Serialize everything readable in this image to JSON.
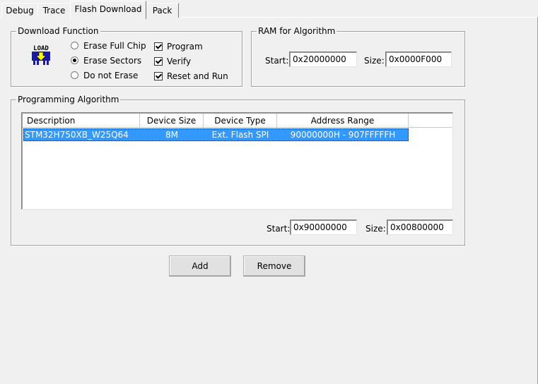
{
  "tabs": [
    {
      "label": "Debug",
      "active": false
    },
    {
      "label": "Trace",
      "active": false
    },
    {
      "label": "Flash Download",
      "active": true
    },
    {
      "label": "Pack",
      "active": false
    }
  ],
  "download_function": {
    "title": "Download Function",
    "icon": "load-icon",
    "icon_text": "LOAD",
    "radios": [
      {
        "label": "Erase Full Chip",
        "selected": false
      },
      {
        "label": "Erase Sectors",
        "selected": true
      },
      {
        "label": "Do not Erase",
        "selected": false
      }
    ],
    "checks": [
      {
        "label": "Program",
        "checked": true
      },
      {
        "label": "Verify",
        "checked": true
      },
      {
        "label": "Reset and Run",
        "checked": true
      }
    ]
  },
  "ram_algorithm": {
    "title": "RAM for Algorithm",
    "start_label": "Start:",
    "start_value": "0x20000000",
    "size_label": "Size:",
    "size_value": "0x0000F000"
  },
  "programming_algorithm": {
    "title": "Programming Algorithm",
    "columns": [
      "Description",
      "Device Size",
      "Device Type",
      "Address Range"
    ],
    "rows": [
      {
        "description": "STM32H750XB_W25Q64",
        "device_size": "8M",
        "device_type": "Ext. Flash SPI",
        "address_range": "90000000H - 907FFFFFH",
        "selected": true
      }
    ],
    "start_label": "Start:",
    "start_value": "0x90000000",
    "size_label": "Size:",
    "size_value": "0x00800000"
  },
  "buttons": {
    "add": "Add",
    "remove": "Remove"
  },
  "colors": {
    "background": "#f0f0f0",
    "selection": "#3399ff",
    "icon_blue": "#1a1aa6",
    "icon_yellow": "#ffff00"
  }
}
